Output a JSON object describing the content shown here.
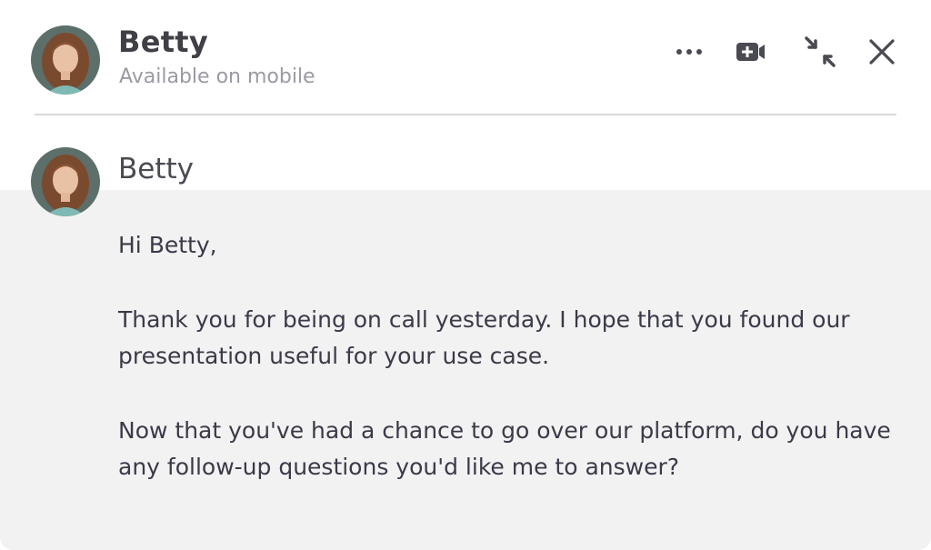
{
  "header": {
    "name": "Betty",
    "status": "Available on mobile",
    "actions": [
      {
        "icon": "more-icon"
      },
      {
        "icon": "video-add-icon"
      },
      {
        "icon": "minimize-icon"
      },
      {
        "icon": "close-icon"
      }
    ]
  },
  "message": {
    "author": "Betty",
    "paragraphs": [
      "Hi Betty,",
      "Thank you for being on call yesterday. I hope that you found our presentation useful for your use case.",
      "Now that you've had a chance to go over our platform, do you have any follow-up questions you'd like me to answer?"
    ]
  },
  "colors": {
    "background": "#ffffff",
    "bubble": "#f2f2f3",
    "text": "#3a3a48",
    "muted": "#9a9aa3",
    "icon": "#4a4a52"
  }
}
